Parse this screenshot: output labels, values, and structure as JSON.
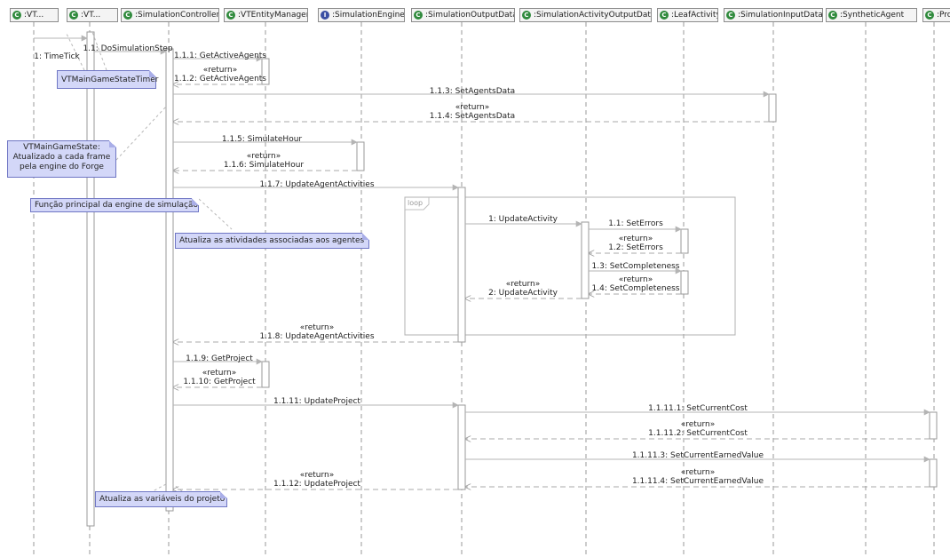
{
  "lifelines": [
    {
      "id": "vt1",
      "label": ":VT...",
      "icon": "class-icon"
    },
    {
      "id": "vt2",
      "label": ":VT...",
      "icon": "class-icon"
    },
    {
      "id": "simctrl",
      "label": ":SimulationController",
      "icon": "class-icon"
    },
    {
      "id": "entmgr",
      "label": ":VTEntityManager",
      "icon": "class-icon"
    },
    {
      "id": "engine",
      "label": ":SimulationEngine",
      "icon": "interface-icon"
    },
    {
      "id": "outdata",
      "label": ":SimulationOutputData",
      "icon": "class-icon"
    },
    {
      "id": "actout",
      "label": ":SimulationActivityOutputData",
      "icon": "class-icon"
    },
    {
      "id": "leaf",
      "label": ":LeafActivity",
      "icon": "class-icon"
    },
    {
      "id": "indata",
      "label": ":SimulationInputData",
      "icon": "class-icon"
    },
    {
      "id": "agent",
      "label": ":SyntheticAgent",
      "icon": "class-icon"
    },
    {
      "id": "proj",
      "label": ":Projec",
      "icon": "class-icon"
    }
  ],
  "messages": [
    {
      "id": "m1",
      "text": "1: TimeTick"
    },
    {
      "id": "m1_1",
      "text": "1.1: DoSimulationStep"
    },
    {
      "id": "m1_1_1",
      "text": "1.1.1: GetActiveAgents"
    },
    {
      "id": "m1_1_2",
      "text": "«return»\n1.1.2: GetActiveAgents"
    },
    {
      "id": "m1_1_3",
      "text": "1.1.3: SetAgentsData"
    },
    {
      "id": "m1_1_4",
      "text": "«return»\n1.1.4: SetAgentsData"
    },
    {
      "id": "m1_1_5",
      "text": "1.1.5: SimulateHour"
    },
    {
      "id": "m1_1_6",
      "text": "«return»\n1.1.6: SimulateHour"
    },
    {
      "id": "m1_1_7",
      "text": "1.1.7: UpdateAgentActivities"
    },
    {
      "id": "mL1",
      "text": "1: UpdateActivity"
    },
    {
      "id": "mL1_1",
      "text": "1.1: SetErrors"
    },
    {
      "id": "mL1_2",
      "text": "«return»\n1.2: SetErrors"
    },
    {
      "id": "mL1_3",
      "text": "1.3: SetCompleteness"
    },
    {
      "id": "mL1_4",
      "text": "«return»\n1.4: SetCompleteness"
    },
    {
      "id": "mL2",
      "text": "«return»\n2: UpdateActivity"
    },
    {
      "id": "m1_1_8",
      "text": "«return»\n1.1.8: UpdateAgentActivities"
    },
    {
      "id": "m1_1_9",
      "text": "1.1.9: GetProject"
    },
    {
      "id": "m1_1_10",
      "text": "«return»\n1.1.10: GetProject"
    },
    {
      "id": "m1_1_11",
      "text": "1.1.11: UpdateProject"
    },
    {
      "id": "m1_1_11_1",
      "text": "1.1.11.1: SetCurrentCost"
    },
    {
      "id": "m1_1_11_2",
      "text": "«return»\n1.1.11.2: SetCurrentCost"
    },
    {
      "id": "m1_1_11_3",
      "text": "1.1.11.3: SetCurrentEarnedValue"
    },
    {
      "id": "m1_1_11_4",
      "text": "«return»\n1.1.11.4: SetCurrentEarnedValue"
    },
    {
      "id": "m1_1_12",
      "text": "«return»\n1.1.12: UpdateProject"
    }
  ],
  "notes": [
    {
      "id": "n_timer",
      "text": "VTMainGameStateTimer"
    },
    {
      "id": "n_state",
      "text": "VTMainGameState:\nAtualizado a cada frame\npela engine do Forge"
    },
    {
      "id": "n_main",
      "text": "Função principal da engine de simulação"
    },
    {
      "id": "n_agents",
      "text": "Atualiza as atividades associadas aos agentes"
    },
    {
      "id": "n_project",
      "text": "Atualiza as variáveis do projeto"
    }
  ],
  "fragments": [
    {
      "id": "loop1",
      "operator": "loop"
    }
  ],
  "colors": {
    "lifeline_header_bg": "#f4f4f4",
    "class_icon": "#2f8a3c",
    "interface_icon": "#3a4fa3",
    "note_bg": "#d3d7f8",
    "note_border": "#6f76c4",
    "line": "#9a9a9a"
  }
}
